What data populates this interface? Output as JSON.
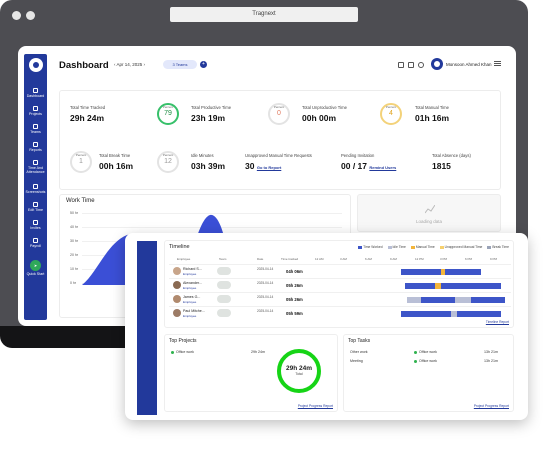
{
  "browser": {
    "title": "Tragnext"
  },
  "sidebar": {
    "items": [
      {
        "label": "Dashboard"
      },
      {
        "label": "Projects"
      },
      {
        "label": "Teams"
      },
      {
        "label": "Reports"
      },
      {
        "label": "Time And Attendance"
      },
      {
        "label": "Screenshots"
      },
      {
        "label": "Edit Time"
      },
      {
        "label": "Invites"
      },
      {
        "label": "Payroll"
      }
    ],
    "quick_start": "Quick Start"
  },
  "header": {
    "title": "Dashboard",
    "date": "Apr 14, 2025",
    "teams_chip": "3 Teams",
    "user": "Monsoon Ahmed Khan"
  },
  "stats": {
    "total_time_tracked": {
      "label": "Total Time Tracked",
      "value": "29h 24m"
    },
    "total_productive_time": {
      "label": "Total Productive Time",
      "value": "23h 19m",
      "percent_caption": "Percent",
      "percent": "79"
    },
    "total_unproductive_time": {
      "label": "Total Unproductive Time",
      "value": "00h 00m",
      "percent_caption": "Percent",
      "percent": "0"
    },
    "total_manual_time": {
      "label": "Total Manual Time",
      "value": "01h 16m",
      "percent_caption": "Percent",
      "percent": "4"
    },
    "total_break_time": {
      "label": "Total Break Time",
      "value": "00h 16m",
      "percent_caption": "Percent",
      "percent": "1"
    },
    "idle_minutes": {
      "label": "Idle Minutes",
      "value": "03h 39m",
      "percent_caption": "Percent",
      "percent": "12"
    },
    "unapproved_manual": {
      "label": "Unapproved Manual Time Requests",
      "value": "30",
      "link": "Go to Report"
    },
    "pending_invitation": {
      "label": "Pending Invitation",
      "value": "00 / 17",
      "link": "Remind Users"
    },
    "total_absence": {
      "label": "Total Absence (days)",
      "value": "1815"
    }
  },
  "work_time": {
    "title": "Work Time",
    "y_ticks": [
      "50 hr",
      "40 hr",
      "30 hr",
      "20 hr",
      "10 hr",
      "0 hr"
    ]
  },
  "loading": {
    "text": "Loading data"
  },
  "timeline": {
    "title": "Timeline",
    "legend": [
      {
        "label": "Time Worked",
        "color": "#3d55c8"
      },
      {
        "label": "Idle Time",
        "color": "#b9bfd6"
      },
      {
        "label": "Manual Time",
        "color": "#f3b53b"
      },
      {
        "label": "Unapproved Manual Time",
        "color": "#f6d06e"
      },
      {
        "label": "Break Time",
        "color": "#9aa3b8"
      }
    ],
    "columns": [
      "Employee",
      "Team",
      "Date",
      "Time tracked",
      "12 AM",
      "3 AM",
      "6 AM",
      "9 AM",
      "12 PM",
      "3 PM",
      "6 PM",
      "9 PM"
    ],
    "rows": [
      {
        "name": "Richard S...",
        "role": "Employee",
        "date": "2025-04-14",
        "tracked": "04h 06m"
      },
      {
        "name": "Alexander...",
        "role": "Employee",
        "date": "2025-04-14",
        "tracked": "05h 26m"
      },
      {
        "name": "James G...",
        "role": "Employee",
        "date": "2025-04-14",
        "tracked": "05h 26m"
      },
      {
        "name": "Paul Mitche...",
        "role": "Employee",
        "date": "2025-04-14",
        "tracked": "05h 59m"
      }
    ],
    "link": "Timeline Report"
  },
  "top_projects": {
    "title": "Top Projects",
    "items": [
      {
        "name": "Office work",
        "time": "29h 24m"
      }
    ],
    "donut_value": "29h 24m",
    "donut_caption": "Total",
    "link": "Project Progress Report"
  },
  "top_tasks": {
    "title": "Top Tasks",
    "items": [
      {
        "task": "Other work",
        "project": "Office work",
        "time": "13h 21m"
      },
      {
        "task": "Meeting",
        "project": "Office work",
        "time": "13h 21m"
      }
    ],
    "link": "Project Progress Report"
  }
}
